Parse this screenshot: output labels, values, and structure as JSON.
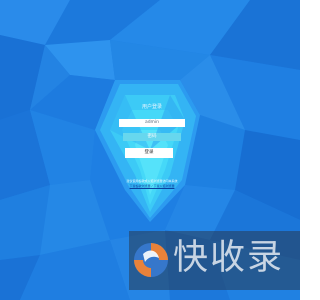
{
  "login": {
    "title": "用户登录",
    "username_value": "admin",
    "password_placeholder": "密码",
    "submit_label": "登录"
  },
  "footer": {
    "browser_note": "建议使用谷歌或火狐浏览器访问本系统",
    "browser_link": "下载谷歌浏览器 / 下载火狐浏览器"
  },
  "watermark": {
    "text": "快收录"
  },
  "colors": {
    "background": "#1e7fe3",
    "panel_highlight": "#38d6f5",
    "password_field": "#67d7ee",
    "link": "#0b3f9e"
  }
}
